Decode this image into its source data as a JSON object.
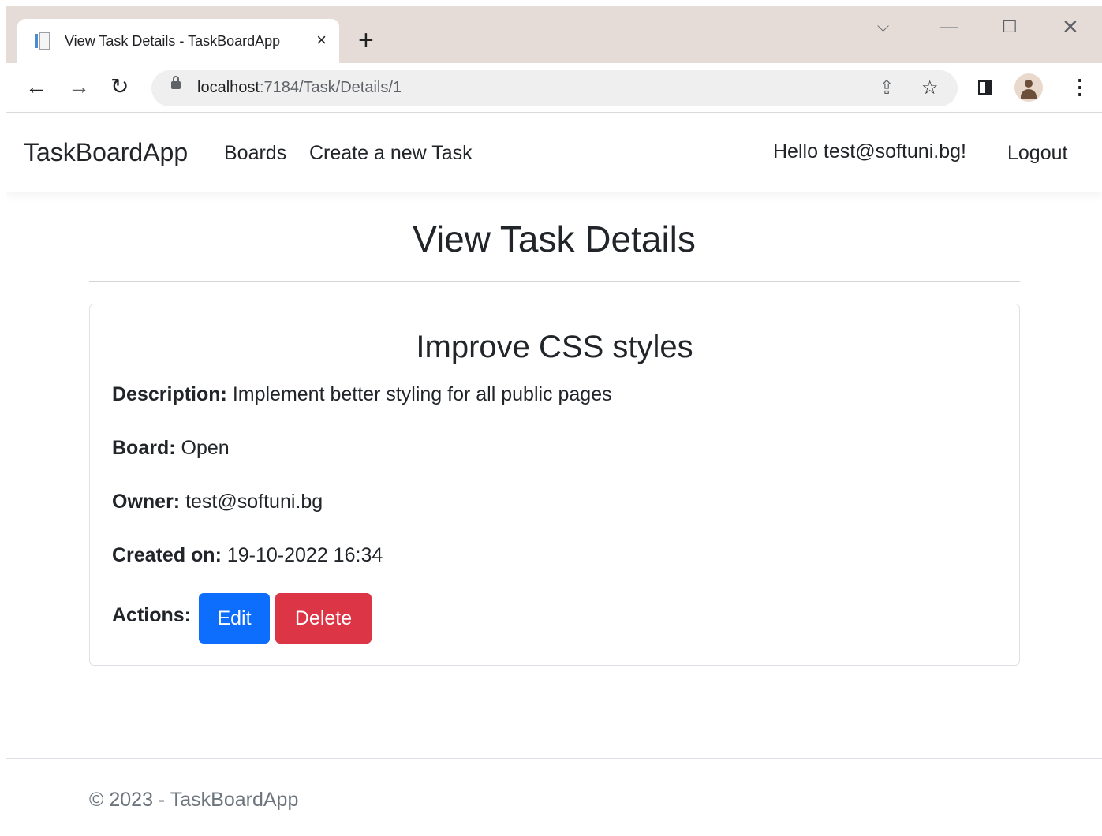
{
  "browser": {
    "tab_title": "View Task Details - TaskBoardApp",
    "tab_close_icon": "×",
    "new_tab_icon": "+",
    "url_host": "localhost",
    "url_rest": ":7184/Task/Details/1",
    "window_controls": {
      "dropdown": "⌵",
      "minimize": "—",
      "maximize": "☐",
      "close": "✕"
    },
    "nav": {
      "back": "←",
      "forward": "→",
      "reload": "↻"
    },
    "icons": {
      "share": "⇪",
      "star": "☆",
      "menu": "⋮"
    }
  },
  "navbar": {
    "brand": "TaskBoardApp",
    "links": [
      "Boards",
      "Create a new Task"
    ],
    "greeting": "Hello test@softuni.bg!",
    "logout": "Logout"
  },
  "page": {
    "title": "View Task Details"
  },
  "task": {
    "title": "Improve CSS styles",
    "description_label": "Description:",
    "description": "Implement better styling for all public pages",
    "board_label": "Board:",
    "board": "Open",
    "owner_label": "Owner:",
    "owner": "test@softuni.bg",
    "created_label": "Created on:",
    "created": "19-10-2022 16:34",
    "actions_label": "Actions:",
    "edit_label": "Edit",
    "delete_label": "Delete"
  },
  "colors": {
    "edit_button": "#0d6efd",
    "delete_button": "#dc3545"
  },
  "footer": {
    "text": "© 2023 - TaskBoardApp"
  }
}
